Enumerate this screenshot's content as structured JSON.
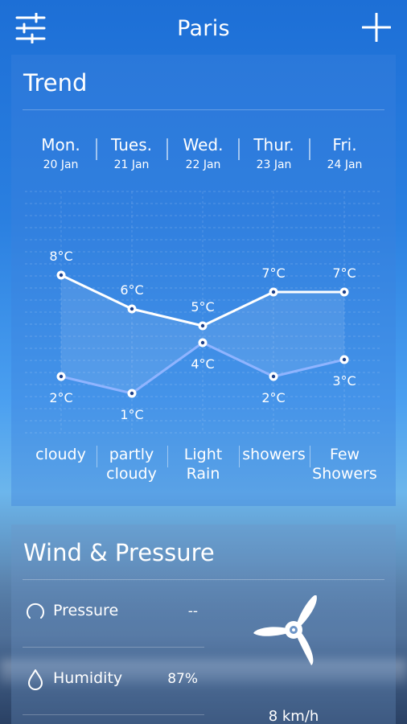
{
  "header": {
    "city": "Paris",
    "menu_icon": "sliders-icon",
    "add_icon": "plus-icon"
  },
  "trend": {
    "title": "Trend",
    "days": [
      {
        "name": "Mon.",
        "date": "20 Jan",
        "condition": "cloudy"
      },
      {
        "name": "Tues.",
        "date": "21 Jan",
        "condition": "partly cloudy"
      },
      {
        "name": "Wed.",
        "date": "22 Jan",
        "condition": "Light Rain"
      },
      {
        "name": "Thur.",
        "date": "23 Jan",
        "condition": "showers"
      },
      {
        "name": "Fri.",
        "date": "24 Jan",
        "condition": "Few Showers"
      }
    ]
  },
  "chart_data": {
    "type": "line",
    "categories": [
      "Mon.",
      "Tues.",
      "Wed.",
      "Thur.",
      "Fri."
    ],
    "series": [
      {
        "values": [
          8,
          6,
          5,
          7,
          7
        ],
        "labels": [
          "8°C",
          "6°C",
          "5°C",
          "7°C",
          "7°C"
        ],
        "color": "#ffffff"
      },
      {
        "values": [
          2,
          1,
          4,
          2,
          3
        ],
        "labels": [
          "2°C",
          "1°C",
          "4°C",
          "2°C",
          "3°C"
        ],
        "color": "#8fb4ff"
      }
    ],
    "grid": true
  },
  "wind": {
    "title": "Wind & Pressure",
    "pressure_label": "Pressure",
    "pressure_value": "--",
    "pressure_icon": "pressure-gauge-icon",
    "humidity_label": "Humidity",
    "humidity_value": "87%",
    "humidity_icon": "water-drop-icon",
    "wind_speed": "8 km/h",
    "wind_icon": "wind-turbine-icon"
  }
}
